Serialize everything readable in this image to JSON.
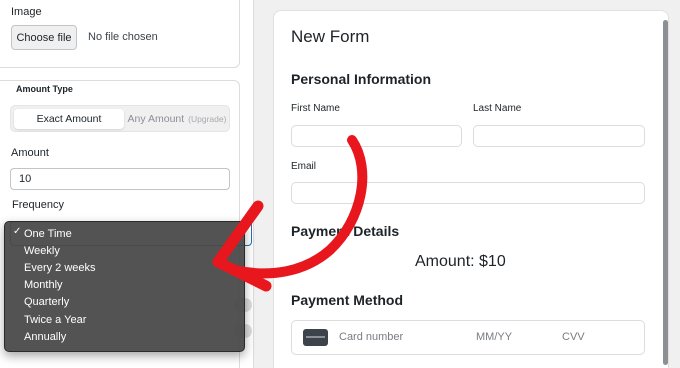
{
  "image_field": {
    "label": "Image",
    "choose_button": "Choose file",
    "no_file_text": "No file chosen"
  },
  "amount_type": {
    "label": "Amount Type",
    "options": [
      "Exact Amount",
      "Any Amount"
    ],
    "upgrade_tag": "(Upgrade)",
    "selected": "Exact Amount"
  },
  "amount": {
    "label": "Amount",
    "value": "10"
  },
  "frequency": {
    "label": "Frequency",
    "selected": "One Time",
    "check_glyph": "✓",
    "options": [
      "One Time",
      "Weekly",
      "Every 2 weeks",
      "Monthly",
      "Quarterly",
      "Twice a Year",
      "Annually"
    ]
  },
  "form_preview": {
    "title": "New Form",
    "personal_section": "Personal Information",
    "first_name_label": "First Name",
    "last_name_label": "Last Name",
    "email_label": "Email",
    "payment_section": "Payment Details",
    "amount_text": "Amount: $10",
    "method_section": "Payment Method",
    "card_number_placeholder": "Card number",
    "expiry_placeholder": "MM/YY",
    "cvv_placeholder": "CVV"
  },
  "colors": {
    "annotation_arrow": "#e8161d",
    "dropdown_bg": "#484848",
    "focus_border": "#2271b1"
  },
  "icons": [
    "checkmark-icon",
    "credit-card-icon",
    "annotation-arrow-icon"
  ]
}
